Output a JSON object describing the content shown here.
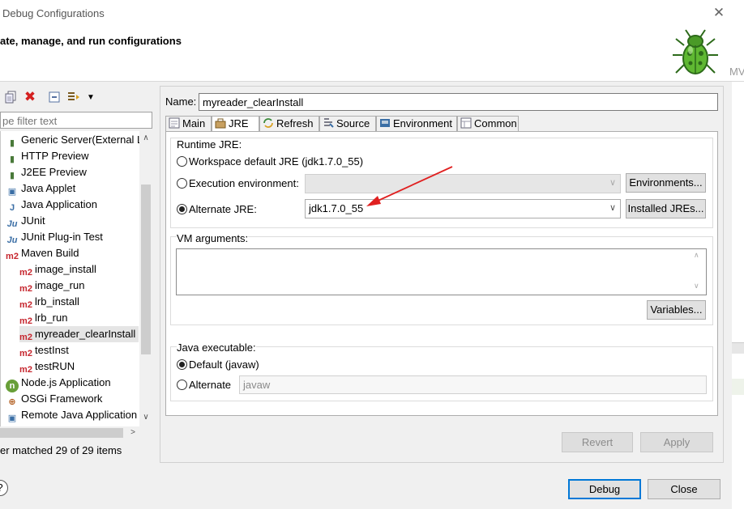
{
  "window": {
    "title": "Debug Configurations",
    "close_glyph": "✕"
  },
  "banner": {
    "title": "ate, manage, and run configurations",
    "side_text": "MV"
  },
  "left": {
    "filter_placeholder": "pe filter text",
    "tree": [
      {
        "label": "Generic Server(External L",
        "icon": "generic-server-icon",
        "glyph": "▮",
        "indent": 0
      },
      {
        "label": "HTTP Preview",
        "icon": "http-preview-icon",
        "glyph": "▮",
        "indent": 0
      },
      {
        "label": "J2EE Preview",
        "icon": "j2ee-preview-icon",
        "glyph": "▮",
        "indent": 0
      },
      {
        "label": "Java Applet",
        "icon": "java-applet-icon",
        "glyph": "▣",
        "indent": 0
      },
      {
        "label": "Java Application",
        "icon": "java-application-icon",
        "glyph": "J",
        "indent": 0
      },
      {
        "label": "JUnit",
        "icon": "junit-icon",
        "glyph": "Ju",
        "indent": 0
      },
      {
        "label": "JUnit Plug-in Test",
        "icon": "junit-plugin-icon",
        "glyph": "Ju",
        "indent": 0
      },
      {
        "label": "Maven Build",
        "icon": "maven-icon",
        "glyph": "m2",
        "indent": 0
      },
      {
        "label": "image_install",
        "icon": "maven-icon",
        "glyph": "m2",
        "indent": 1
      },
      {
        "label": "image_run",
        "icon": "maven-icon",
        "glyph": "m2",
        "indent": 1
      },
      {
        "label": "lrb_install",
        "icon": "maven-icon",
        "glyph": "m2",
        "indent": 1
      },
      {
        "label": "lrb_run",
        "icon": "maven-icon",
        "glyph": "m2",
        "indent": 1
      },
      {
        "label": "myreader_clearInstall",
        "icon": "maven-icon",
        "glyph": "m2",
        "indent": 1,
        "selected": true
      },
      {
        "label": "testInst",
        "icon": "maven-icon",
        "glyph": "m2",
        "indent": 1
      },
      {
        "label": "testRUN",
        "icon": "maven-icon",
        "glyph": "m2",
        "indent": 1
      },
      {
        "label": "Node.js Application",
        "icon": "nodejs-icon",
        "glyph": "n",
        "indent": 0
      },
      {
        "label": "OSGi Framework",
        "icon": "osgi-icon",
        "glyph": "⊕",
        "indent": 0
      },
      {
        "label": "Remote Java Application",
        "icon": "remote-java-icon",
        "glyph": "▣",
        "indent": 0
      }
    ],
    "status": "er matched 29 of 29 items"
  },
  "right": {
    "name_label": "Name:",
    "name_value": "myreader_clearInstall",
    "tabs": [
      {
        "label": "Main",
        "icon": "main-tab-icon"
      },
      {
        "label": "JRE",
        "icon": "jre-tab-icon",
        "active": true
      },
      {
        "label": "Refresh",
        "icon": "refresh-tab-icon"
      },
      {
        "label": "Source",
        "icon": "source-tab-icon"
      },
      {
        "label": "Environment",
        "icon": "environment-tab-icon"
      },
      {
        "label": "Common",
        "icon": "common-tab-icon"
      }
    ],
    "runtime_jre": {
      "group_label": "Runtime JRE:",
      "workspace_default": "Workspace default JRE (jdk1.7.0_55)",
      "execution_env": "Execution environment:",
      "environments_button": "Environments...",
      "alternate_jre": "Alternate JRE:",
      "alternate_jre_value": "jdk1.7.0_55",
      "installed_jres_button": "Installed JREs..."
    },
    "vm": {
      "group_label": "VM arguments:",
      "variables_button": "Variables..."
    },
    "java_exec": {
      "group_label": "Java executable:",
      "default_label": "Default (javaw)",
      "alternate_label": "Alternate",
      "alternate_value": "javaw"
    },
    "revert_button": "Revert",
    "apply_button": "Apply"
  },
  "footer": {
    "help": "?",
    "debug_button": "Debug",
    "close_button": "Close"
  },
  "colors": {
    "annotation_arrow": "#e02020",
    "maven_red": "#c6262e",
    "focus_blue": "#0078d7"
  }
}
